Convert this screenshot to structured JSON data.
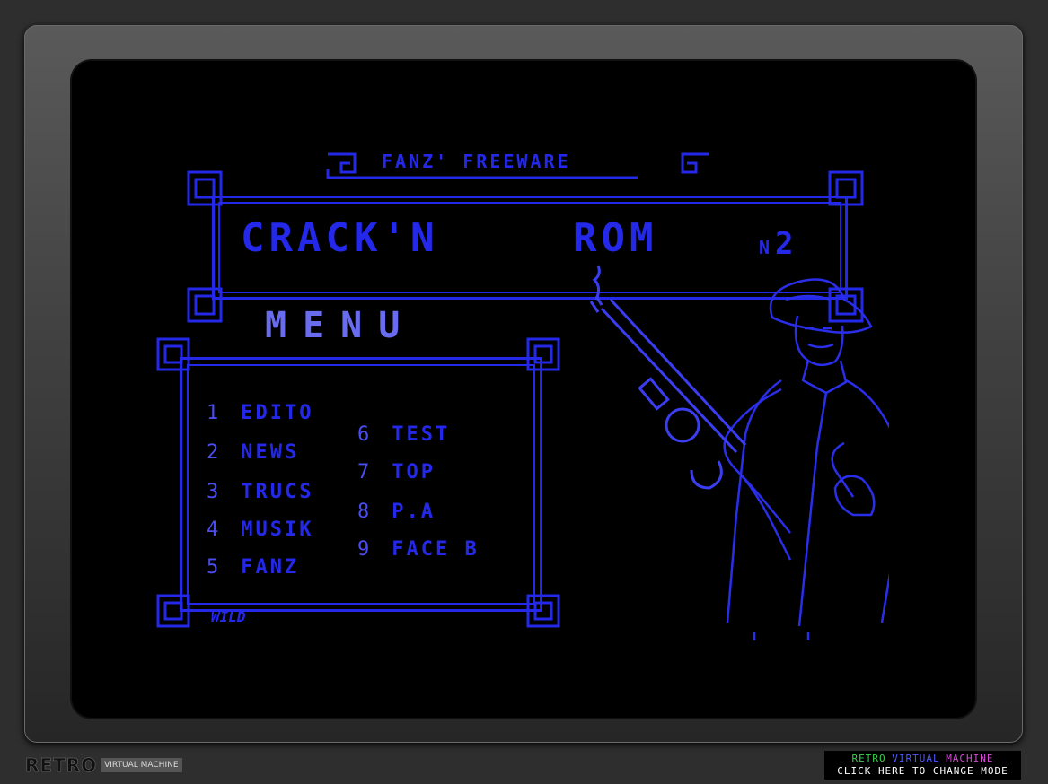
{
  "header": {
    "tagline": "FANZ' FREEWARE",
    "title_left": "CRACK'N",
    "title_right": "ROM",
    "issue_prefix": "N",
    "issue_number": "2"
  },
  "menu": {
    "heading": "MENU",
    "items": [
      {
        "num": "1",
        "label": "EDITO"
      },
      {
        "num": "2",
        "label": "NEWS"
      },
      {
        "num": "3",
        "label": "TRUCS"
      },
      {
        "num": "4",
        "label": "MUSIK"
      },
      {
        "num": "5",
        "label": "FANZ"
      },
      {
        "num": "6",
        "label": "TEST"
      },
      {
        "num": "7",
        "label": "TOP"
      },
      {
        "num": "8",
        "label": "P.A"
      },
      {
        "num": "9",
        "label": "FACE B"
      }
    ],
    "signature": "WILD"
  },
  "footer": {
    "logo_big": "RETRO",
    "logo_small": "VIRTUAL MACHINE",
    "mode_line1": [
      "RETRO",
      "VIRTUAL",
      "MACHINE"
    ],
    "mode_line1_colors": [
      "#34d34a",
      "#4b58ff",
      "#d44ad4"
    ],
    "mode_line2": "CLICK HERE TO CHANGE MODE"
  },
  "colors": {
    "screen_blue": "#2428e8",
    "screen_pale": "#6a6cf0",
    "screen_bg": "#000000",
    "bezel": "#404040"
  }
}
